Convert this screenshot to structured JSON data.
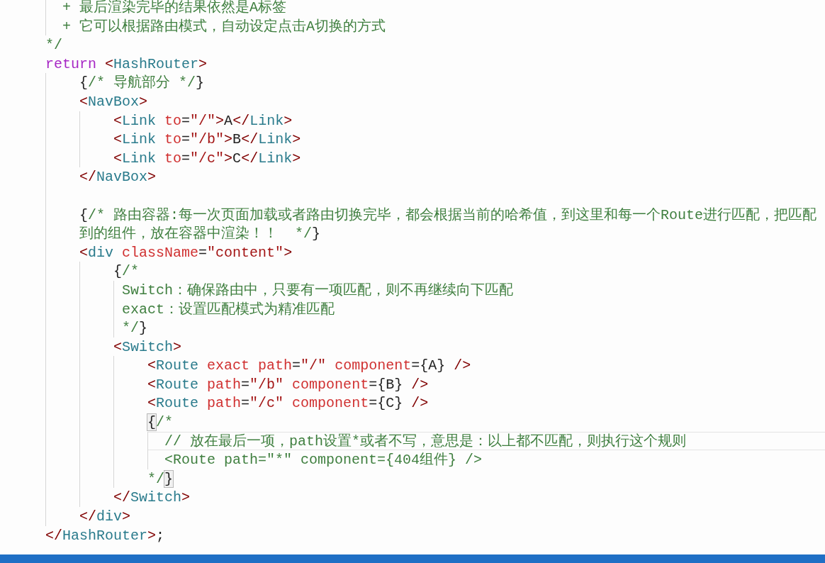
{
  "editor": {
    "lines": [
      {
        "current": false,
        "tokens": [
          {
            "kind": "comment",
            "text": "  + 最后渲染完毕的结果依然是A标签"
          }
        ]
      },
      {
        "current": false,
        "tokens": [
          {
            "kind": "comment",
            "text": "  + 它可以根据路由模式，自动设定点击A切换的方式"
          }
        ]
      },
      {
        "current": false,
        "tokens": [
          {
            "kind": "comment",
            "text": "*/"
          }
        ]
      },
      {
        "current": false,
        "tokens": [
          {
            "kind": "keyword",
            "text": "return"
          },
          {
            "kind": "punct",
            "text": " <"
          },
          {
            "kind": "tag",
            "text": "HashRouter"
          },
          {
            "kind": "punct",
            "text": ">"
          }
        ],
        "children": [
          {
            "current": false,
            "tokens": [
              {
                "kind": "plain",
                "text": "{"
              },
              {
                "kind": "comment",
                "text": "/* 导航部分 */"
              },
              {
                "kind": "plain",
                "text": "}"
              }
            ]
          },
          {
            "current": false,
            "tokens": [
              {
                "kind": "punct",
                "text": "<"
              },
              {
                "kind": "tag",
                "text": "NavBox"
              },
              {
                "kind": "punct",
                "text": ">"
              }
            ],
            "children": [
              {
                "current": false,
                "tokens": [
                  {
                    "kind": "punct",
                    "text": "<"
                  },
                  {
                    "kind": "tag",
                    "text": "Link"
                  },
                  {
                    "kind": "attr",
                    "text": " to"
                  },
                  {
                    "kind": "plain",
                    "text": "="
                  },
                  {
                    "kind": "string",
                    "text": "\"/\""
                  },
                  {
                    "kind": "punct",
                    "text": ">"
                  },
                  {
                    "kind": "plain",
                    "text": "A"
                  },
                  {
                    "kind": "punct",
                    "text": "</"
                  },
                  {
                    "kind": "tag",
                    "text": "Link"
                  },
                  {
                    "kind": "punct",
                    "text": ">"
                  }
                ]
              },
              {
                "current": false,
                "tokens": [
                  {
                    "kind": "punct",
                    "text": "<"
                  },
                  {
                    "kind": "tag",
                    "text": "Link"
                  },
                  {
                    "kind": "attr",
                    "text": " to"
                  },
                  {
                    "kind": "plain",
                    "text": "="
                  },
                  {
                    "kind": "string",
                    "text": "\"/b\""
                  },
                  {
                    "kind": "punct",
                    "text": ">"
                  },
                  {
                    "kind": "plain",
                    "text": "B"
                  },
                  {
                    "kind": "punct",
                    "text": "</"
                  },
                  {
                    "kind": "tag",
                    "text": "Link"
                  },
                  {
                    "kind": "punct",
                    "text": ">"
                  }
                ]
              },
              {
                "current": false,
                "tokens": [
                  {
                    "kind": "punct",
                    "text": "<"
                  },
                  {
                    "kind": "tag",
                    "text": "Link"
                  },
                  {
                    "kind": "attr",
                    "text": " to"
                  },
                  {
                    "kind": "plain",
                    "text": "="
                  },
                  {
                    "kind": "string",
                    "text": "\"/c\""
                  },
                  {
                    "kind": "punct",
                    "text": ">"
                  },
                  {
                    "kind": "plain",
                    "text": "C"
                  },
                  {
                    "kind": "punct",
                    "text": "</"
                  },
                  {
                    "kind": "tag",
                    "text": "Link"
                  },
                  {
                    "kind": "punct",
                    "text": ">"
                  }
                ]
              }
            ]
          },
          {
            "current": false,
            "tokens": [
              {
                "kind": "punct",
                "text": "</"
              },
              {
                "kind": "tag",
                "text": "NavBox"
              },
              {
                "kind": "punct",
                "text": ">"
              }
            ]
          },
          {
            "current": false
          },
          {
            "current": false,
            "tokens": [
              {
                "kind": "plain",
                "text": "{"
              },
              {
                "kind": "comment",
                "text": "/* 路由容器:每一次页面加载或者路由切换完毕，都会根据当前的哈希值，到这里和每一个Route进行匹配，把匹配"
              }
            ]
          },
          {
            "current": false,
            "tokens": [
              {
                "kind": "comment",
                "text": "到的组件，放在容器中渲染！！  */"
              },
              {
                "kind": "plain",
                "text": "}"
              }
            ]
          },
          {
            "current": false,
            "tokens": [
              {
                "kind": "punct",
                "text": "<"
              },
              {
                "kind": "tag",
                "text": "div"
              },
              {
                "kind": "attr",
                "text": " className"
              },
              {
                "kind": "plain",
                "text": "="
              },
              {
                "kind": "string",
                "text": "\"content\""
              },
              {
                "kind": "punct",
                "text": ">"
              }
            ],
            "children": [
              {
                "current": false,
                "tokens": [
                  {
                    "kind": "plain",
                    "text": "{"
                  },
                  {
                    "kind": "comment",
                    "text": "/*"
                  }
                ]
              },
              {
                "current": false,
                "tokens": [
                  {
                    "kind": "comment",
                    "text": " Switch：确保路由中，只要有一项匹配，则不再继续向下匹配"
                  }
                ]
              },
              {
                "current": false,
                "tokens": [
                  {
                    "kind": "comment",
                    "text": " exact：设置匹配模式为精准匹配"
                  }
                ]
              },
              {
                "current": false,
                "tokens": [
                  {
                    "kind": "comment",
                    "text": " */"
                  },
                  {
                    "kind": "plain",
                    "text": "}"
                  }
                ]
              },
              {
                "current": false,
                "tokens": [
                  {
                    "kind": "punct",
                    "text": "<"
                  },
                  {
                    "kind": "tag",
                    "text": "Switch"
                  },
                  {
                    "kind": "punct",
                    "text": ">"
                  }
                ],
                "children": [
                  {
                    "current": false,
                    "tokens": [
                      {
                        "kind": "punct",
                        "text": "<"
                      },
                      {
                        "kind": "tag",
                        "text": "Route"
                      },
                      {
                        "kind": "attr",
                        "text": " exact path"
                      },
                      {
                        "kind": "plain",
                        "text": "="
                      },
                      {
                        "kind": "string",
                        "text": "\"/\""
                      },
                      {
                        "kind": "attr",
                        "text": " component"
                      },
                      {
                        "kind": "plain",
                        "text": "={A}"
                      },
                      {
                        "kind": "punct",
                        "text": " />"
                      }
                    ]
                  },
                  {
                    "current": false,
                    "tokens": [
                      {
                        "kind": "punct",
                        "text": "<"
                      },
                      {
                        "kind": "tag",
                        "text": "Route"
                      },
                      {
                        "kind": "attr",
                        "text": " path"
                      },
                      {
                        "kind": "plain",
                        "text": "="
                      },
                      {
                        "kind": "string",
                        "text": "\"/b\""
                      },
                      {
                        "kind": "attr",
                        "text": " component"
                      },
                      {
                        "kind": "plain",
                        "text": "={B}"
                      },
                      {
                        "kind": "punct",
                        "text": " />"
                      }
                    ]
                  },
                  {
                    "current": false,
                    "tokens": [
                      {
                        "kind": "punct",
                        "text": "<"
                      },
                      {
                        "kind": "tag",
                        "text": "Route"
                      },
                      {
                        "kind": "attr",
                        "text": " path"
                      },
                      {
                        "kind": "plain",
                        "text": "="
                      },
                      {
                        "kind": "string",
                        "text": "\"/c\""
                      },
                      {
                        "kind": "attr",
                        "text": " component"
                      },
                      {
                        "kind": "plain",
                        "text": "={C}"
                      },
                      {
                        "kind": "punct",
                        "text": " />"
                      }
                    ]
                  },
                  {
                    "current": false,
                    "tokens": [
                      {
                        "kind": "match",
                        "text": "{"
                      },
                      {
                        "kind": "comment",
                        "text": "/*"
                      }
                    ]
                  },
                  {
                    "current": true,
                    "tokens": [
                      {
                        "kind": "comment",
                        "text": "  // 放在最后一项，path设置*或者不写，意思是：以上都不匹配，则执行这个规则"
                      }
                    ]
                  },
                  {
                    "current": false,
                    "tokens": [
                      {
                        "kind": "comment",
                        "text": "  <Route path=\"*\" component={404组件} />"
                      }
                    ]
                  },
                  {
                    "current": false,
                    "tokens": [
                      {
                        "kind": "comment",
                        "text": "*/"
                      },
                      {
                        "kind": "match",
                        "text": "}"
                      }
                    ]
                  }
                ]
              },
              {
                "current": false,
                "tokens": [
                  {
                    "kind": "punct",
                    "text": "</"
                  },
                  {
                    "kind": "tag",
                    "text": "Switch"
                  },
                  {
                    "kind": "punct",
                    "text": ">"
                  }
                ]
              }
            ]
          },
          {
            "current": false,
            "tokens": [
              {
                "kind": "punct",
                "text": "</"
              },
              {
                "kind": "tag",
                "text": "div"
              },
              {
                "kind": "punct",
                "text": ">"
              }
            ]
          }
        ]
      },
      {
        "current": false,
        "tokens": [
          {
            "kind": "punct",
            "text": "</"
          },
          {
            "kind": "tag",
            "text": "HashRouter"
          },
          {
            "kind": "punct",
            "text": ">"
          },
          {
            "kind": "plain",
            "text": ";"
          }
        ]
      }
    ]
  }
}
